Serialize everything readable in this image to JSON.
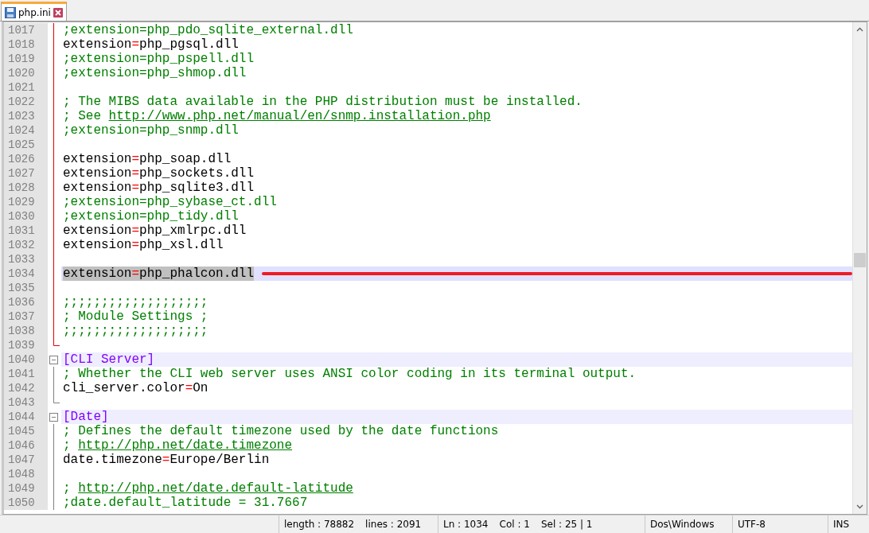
{
  "tabs": [
    {
      "label": "php.ini",
      "selected": true
    }
  ],
  "lines": [
    {
      "number": "1017",
      "kind": "comment",
      "text": ";extension=php_pdo_sqlite_external.dll",
      "fold_active": true,
      "fold_start": false,
      "fold_end": false,
      "selected": false
    },
    {
      "number": "1018",
      "kind": "setting",
      "key": "extension",
      "op": "=",
      "value": "php_pgsql.dll",
      "fold_active": true,
      "fold_start": false,
      "fold_end": false,
      "selected": false
    },
    {
      "number": "1019",
      "kind": "comment",
      "text": ";extension=php_pspell.dll",
      "fold_active": true,
      "fold_start": false,
      "fold_end": false,
      "selected": false
    },
    {
      "number": "1020",
      "kind": "comment",
      "text": ";extension=php_shmop.dll",
      "fold_active": true,
      "fold_start": false,
      "fold_end": false,
      "selected": false
    },
    {
      "number": "1021",
      "kind": "blank",
      "fold_active": true,
      "fold_start": false,
      "fold_end": false,
      "selected": false
    },
    {
      "number": "1022",
      "kind": "comment",
      "text": "; The MIBS data available in the PHP distribution must be installed.",
      "fold_active": true,
      "fold_start": false,
      "fold_end": false,
      "selected": false
    },
    {
      "number": "1023",
      "kind": "comment",
      "text": "; See ",
      "link": "http://www.php.net/manual/en/snmp.installation.php",
      "fold_active": true,
      "fold_start": false,
      "fold_end": false,
      "selected": false
    },
    {
      "number": "1024",
      "kind": "comment",
      "text": ";extension=php_snmp.dll",
      "fold_active": true,
      "fold_start": false,
      "fold_end": false,
      "selected": false
    },
    {
      "number": "1025",
      "kind": "blank",
      "fold_active": true,
      "fold_start": false,
      "fold_end": false,
      "selected": false
    },
    {
      "number": "1026",
      "kind": "setting",
      "key": "extension",
      "op": "=",
      "value": "php_soap.dll",
      "fold_active": true,
      "fold_start": false,
      "fold_end": false,
      "selected": false
    },
    {
      "number": "1027",
      "kind": "setting",
      "key": "extension",
      "op": "=",
      "value": "php_sockets.dll",
      "fold_active": true,
      "fold_start": false,
      "fold_end": false,
      "selected": false
    },
    {
      "number": "1028",
      "kind": "setting",
      "key": "extension",
      "op": "=",
      "value": "php_sqlite3.dll",
      "fold_active": true,
      "fold_start": false,
      "fold_end": false,
      "selected": false
    },
    {
      "number": "1029",
      "kind": "comment",
      "text": ";extension=php_sybase_ct.dll",
      "fold_active": true,
      "fold_start": false,
      "fold_end": false,
      "selected": false
    },
    {
      "number": "1030",
      "kind": "comment",
      "text": ";extension=php_tidy.dll",
      "fold_active": true,
      "fold_start": false,
      "fold_end": false,
      "selected": false
    },
    {
      "number": "1031",
      "kind": "setting",
      "key": "extension",
      "op": "=",
      "value": "php_xmlrpc.dll",
      "fold_active": true,
      "fold_start": false,
      "fold_end": false,
      "selected": false
    },
    {
      "number": "1032",
      "kind": "setting",
      "key": "extension",
      "op": "=",
      "value": "php_xsl.dll",
      "fold_active": true,
      "fold_start": false,
      "fold_end": false,
      "selected": false
    },
    {
      "number": "1033",
      "kind": "blank",
      "fold_active": true,
      "fold_start": false,
      "fold_end": false,
      "selected": false
    },
    {
      "number": "1034",
      "kind": "setting",
      "key": "extension",
      "op": "=",
      "value": "php_phalcon.dll",
      "fold_active": true,
      "fold_start": false,
      "fold_end": false,
      "selected": true,
      "annotated": true
    },
    {
      "number": "1035",
      "kind": "blank",
      "fold_active": true,
      "fold_start": false,
      "fold_end": false,
      "selected": false
    },
    {
      "number": "1036",
      "kind": "comment",
      "text": ";;;;;;;;;;;;;;;;;;;",
      "fold_active": true,
      "fold_start": false,
      "fold_end": false,
      "selected": false
    },
    {
      "number": "1037",
      "kind": "comment",
      "text": "; Module Settings ;",
      "fold_active": true,
      "fold_start": false,
      "fold_end": false,
      "selected": false
    },
    {
      "number": "1038",
      "kind": "comment",
      "text": ";;;;;;;;;;;;;;;;;;;",
      "fold_active": true,
      "fold_start": false,
      "fold_end": false,
      "selected": false
    },
    {
      "number": "1039",
      "kind": "blank",
      "fold_active": true,
      "fold_start": false,
      "fold_end": true,
      "selected": false
    },
    {
      "number": "1040",
      "kind": "section",
      "text": "[CLI Server]",
      "fold_active": false,
      "fold_start": true,
      "fold_end": false,
      "selected": false
    },
    {
      "number": "1041",
      "kind": "comment",
      "text": "; Whether the CLI web server uses ANSI color coding in its terminal output.",
      "fold_active": false,
      "fold_start": false,
      "fold_end": false,
      "selected": false
    },
    {
      "number": "1042",
      "kind": "setting",
      "key": "cli_server.color",
      "op": "=",
      "value": "On",
      "fold_active": false,
      "fold_start": false,
      "fold_end": false,
      "selected": false
    },
    {
      "number": "1043",
      "kind": "blank",
      "fold_active": false,
      "fold_start": false,
      "fold_end": true,
      "selected": false
    },
    {
      "number": "1044",
      "kind": "section",
      "text": "[Date]",
      "fold_active": false,
      "fold_start": true,
      "fold_end": false,
      "selected": false
    },
    {
      "number": "1045",
      "kind": "comment",
      "text": "; Defines the default timezone used by the date functions",
      "fold_active": false,
      "fold_start": false,
      "fold_end": false,
      "selected": false
    },
    {
      "number": "1046",
      "kind": "comment",
      "text": "; ",
      "link": "http://php.net/date.timezone",
      "fold_active": false,
      "fold_start": false,
      "fold_end": false,
      "selected": false
    },
    {
      "number": "1047",
      "kind": "setting",
      "key": "date.timezone",
      "op": "=",
      "value": "Europe/Berlin",
      "fold_active": false,
      "fold_start": false,
      "fold_end": false,
      "selected": false
    },
    {
      "number": "1048",
      "kind": "blank",
      "fold_active": false,
      "fold_start": false,
      "fold_end": false,
      "selected": false
    },
    {
      "number": "1049",
      "kind": "comment",
      "text": "; ",
      "link": "http://php.net/date.default-latitude",
      "fold_active": false,
      "fold_start": false,
      "fold_end": false,
      "selected": false
    },
    {
      "number": "1050",
      "kind": "comment",
      "text": ";date.default_latitude = 31.7667",
      "fold_active": false,
      "fold_start": false,
      "fold_end": false,
      "selected": false
    }
  ],
  "status_bar": [
    {
      "items": [
        "length : 78882",
        "lines : 2091"
      ]
    },
    {
      "items": [
        "Ln : 1034",
        "Col : 1",
        "Sel : 25 | 1"
      ]
    },
    {
      "items": [
        "Dos\\Windows"
      ]
    },
    {
      "items": [
        "UTF-8"
      ]
    },
    {
      "items": [
        "INS"
      ]
    }
  ]
}
